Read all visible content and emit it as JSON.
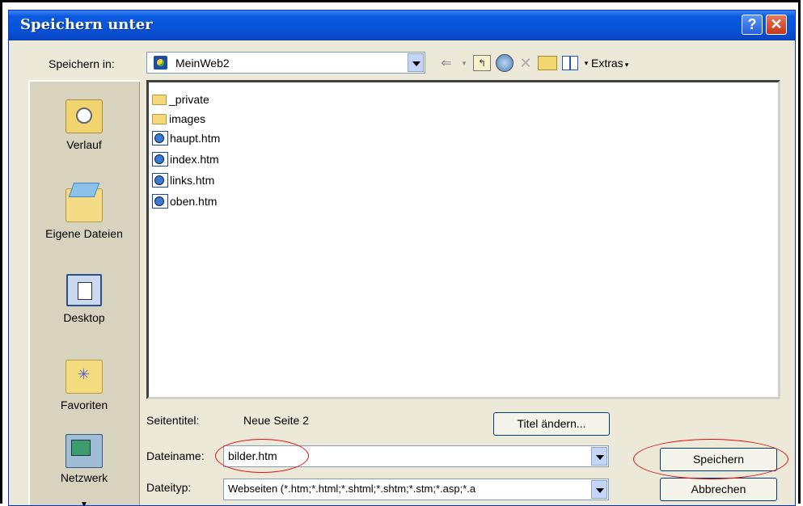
{
  "dialog": {
    "title": "Speichern unter"
  },
  "save_in": {
    "label": "Speichern in:",
    "value": "MeinWeb2"
  },
  "toolbar": {
    "extras_label": "Extras"
  },
  "places": [
    {
      "label": "Verlauf",
      "icon": "history-icon"
    },
    {
      "label": "Eigene Dateien",
      "icon": "my-documents-icon"
    },
    {
      "label": "Desktop",
      "icon": "desktop-icon"
    },
    {
      "label": "Favoriten",
      "icon": "favorites-icon"
    },
    {
      "label": "Netzwerk",
      "icon": "network-icon"
    }
  ],
  "files": [
    {
      "name": "_private",
      "type": "folder"
    },
    {
      "name": "images",
      "type": "folder"
    },
    {
      "name": "haupt.htm",
      "type": "htm"
    },
    {
      "name": "index.htm",
      "type": "htm"
    },
    {
      "name": "links.htm",
      "type": "htm"
    },
    {
      "name": "oben.htm",
      "type": "htm"
    }
  ],
  "page_title": {
    "label": "Seitentitel:",
    "value": "Neue Seite 2",
    "change_button": "Titel ändern..."
  },
  "filename": {
    "label": "Dateiname:",
    "value": "bilder.htm"
  },
  "filetype": {
    "label": "Dateityp:",
    "value": "Webseiten (*.htm;*.html;*.shtml;*.shtm;*.stm;*.asp;*.a"
  },
  "buttons": {
    "save": "Speichern",
    "cancel": "Abbrechen"
  },
  "colors": {
    "title_bar": "#0754d8",
    "dialog_bg": "#ece9d8",
    "highlight": "#e01010"
  }
}
